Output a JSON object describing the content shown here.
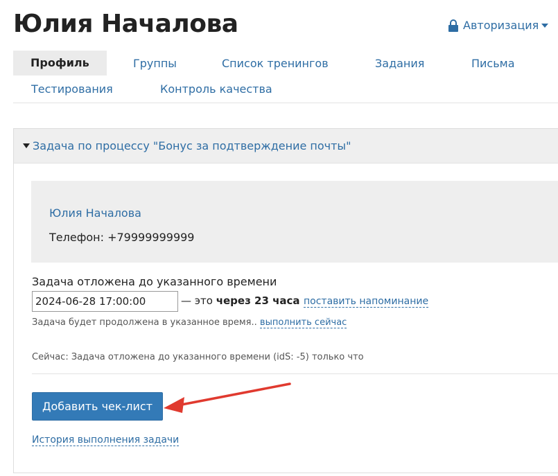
{
  "header": {
    "title": "Юлия Началова",
    "auth_label": "Авторизация"
  },
  "tabs": [
    {
      "label": "Профиль",
      "active": true
    },
    {
      "label": "Группы"
    },
    {
      "label": "Список тренингов"
    },
    {
      "label": "Задания"
    },
    {
      "label": "Письма"
    },
    {
      "label": "Тестирования"
    },
    {
      "label": "Контроль качества"
    }
  ],
  "task": {
    "header_label": "Задача по процессу \"Бонус за подтверждение почты\"",
    "contact_name": "Юлия Началова",
    "contact_phone": "Телефон: +79999999999",
    "deferred_label": "Задача отложена до указанного времени",
    "date_value": "2024-06-28 17:00:00",
    "rel_prefix": "— это",
    "rel_time": "через 23 часа",
    "reminder_link": "поставить напоминание",
    "continue_note": "Задача будет продолжена в указанное время..",
    "run_now_link": "выполнить сейчас",
    "now_status": "Сейчас: Задача отложена до указанного времени (idS: -5) только что",
    "add_checklist_button": "Добавить чек-лист",
    "history_link": "История выполнения задачи"
  },
  "colors": {
    "link": "#2e6da4",
    "primary_button": "#337ab7",
    "annotation_arrow": "#e03a2f",
    "panel_header_bg": "#efefef"
  },
  "icons": {
    "auth": "lock-icon",
    "auth_dropdown": "caret-down-icon",
    "panel_toggle": "triangle-down-icon",
    "annotation": "red-arrow-icon"
  }
}
